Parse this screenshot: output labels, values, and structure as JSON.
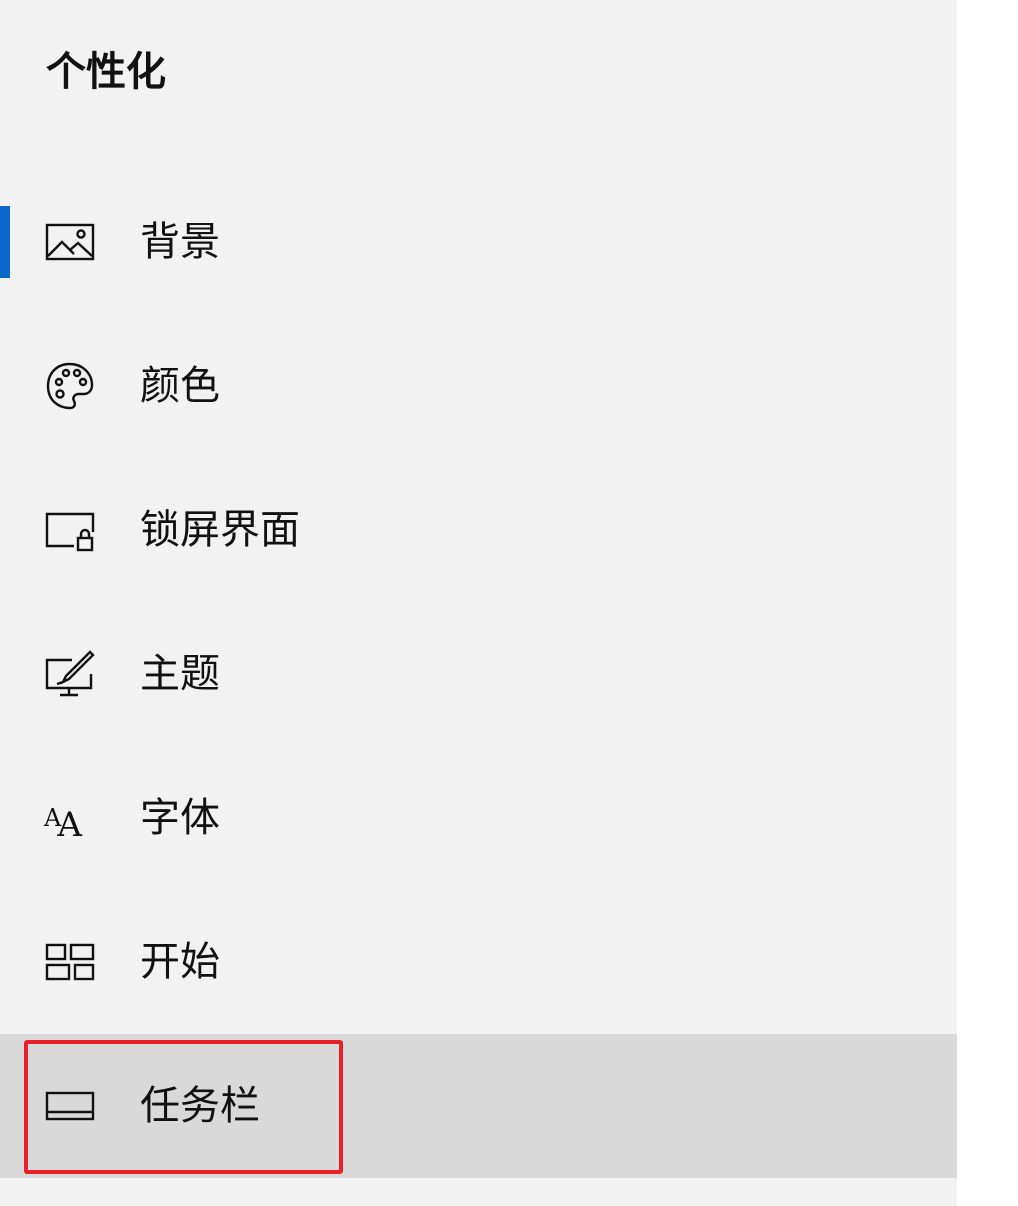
{
  "header": {
    "title": "个性化"
  },
  "colors": {
    "accent": "#0a66c8",
    "highlight_border": "#e8202a",
    "hover_background": "#d9d9d9",
    "panel_background": "#f2f2f2"
  },
  "nav": {
    "items": [
      {
        "label": "背景",
        "icon": "picture-icon",
        "selected": true
      },
      {
        "label": "颜色",
        "icon": "palette-icon"
      },
      {
        "label": "锁屏界面",
        "icon": "lock-screen-icon"
      },
      {
        "label": "主题",
        "icon": "theme-brush-icon"
      },
      {
        "label": "字体",
        "icon": "font-icon",
        "glyph": "AA"
      },
      {
        "label": "开始",
        "icon": "start-tiles-icon"
      },
      {
        "label": "任务栏",
        "icon": "taskbar-icon",
        "hovered": true,
        "highlighted": true
      }
    ]
  }
}
